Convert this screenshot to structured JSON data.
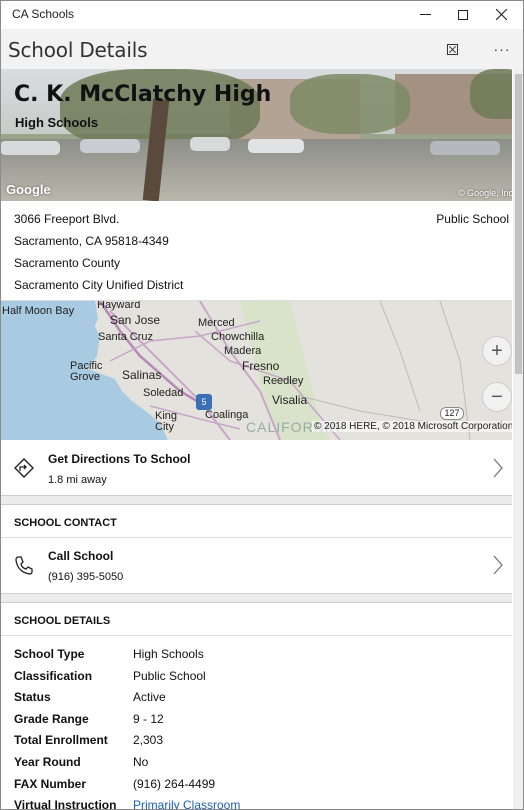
{
  "window": {
    "app_title": "CA Schools"
  },
  "header": {
    "title": "School Details",
    "more_label": "···"
  },
  "photo": {
    "school_name": "C. K. McClatchy High",
    "school_level": "High Schools",
    "logo_text": "Google",
    "copyright": "© Google, Inc"
  },
  "address": {
    "street": "3066 Freeport Blvd.",
    "city_state_zip": "Sacramento, CA 95818-4349",
    "county": "Sacramento County",
    "district": "Sacramento City Unified District",
    "school_type": "Public School"
  },
  "map": {
    "labels": {
      "half_moon_bay": "Half Moon Bay",
      "hayward": "Hayward",
      "san_jose": "San Jose",
      "merced": "Merced",
      "chowchilla": "Chowchilla",
      "madera": "Madera",
      "santa_cruz": "Santa Cruz",
      "fresno": "Fresno",
      "reedley": "Reedley",
      "pacific_grove": "Pacific Grove",
      "salinas": "Salinas",
      "soledad": "Soledad",
      "visalia": "Visalia",
      "king_city": "King City",
      "coalinga": "Coalinga",
      "california": "CALIFORNIA",
      "highway_5": "5",
      "highway_127": "127"
    },
    "zoom_in": "+",
    "zoom_out": "−",
    "copyright": "© 2018 HERE, © 2018 Microsoft Corporation"
  },
  "directions": {
    "title": "Get Directions To School",
    "distance": "1.8 mi away"
  },
  "contact": {
    "section_title": "SCHOOL CONTACT",
    "call_title": "Call School",
    "phone": "(916) 395-5050"
  },
  "details": {
    "section_title": "SCHOOL DETAILS",
    "rows": [
      {
        "label": "School Type",
        "value": "High Schools"
      },
      {
        "label": "Classification",
        "value": "Public School"
      },
      {
        "label": "Status",
        "value": "Active"
      },
      {
        "label": "Grade Range",
        "value": "9 - 12"
      },
      {
        "label": "Total Enrollment",
        "value": "2,303"
      },
      {
        "label": "Year Round",
        "value": "No"
      },
      {
        "label": "FAX Number",
        "value": "(916) 264-4499"
      },
      {
        "label": "Virtual Instruction",
        "value": "Primarily Classroom"
      }
    ]
  },
  "colors": {
    "link": "#1a5fb4",
    "header_bg": "#f2f2f2",
    "gap_bg": "#ececec"
  }
}
